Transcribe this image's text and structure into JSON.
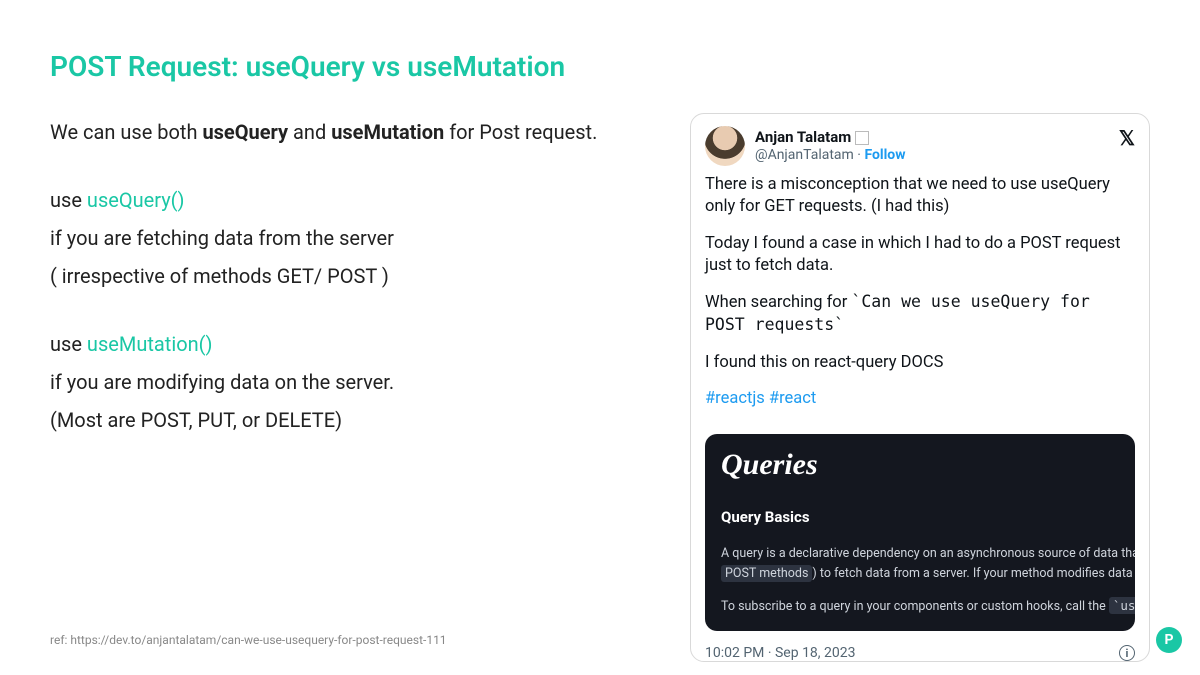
{
  "title": "POST Request: useQuery vs useMutation",
  "left": {
    "intro_pre": "We can use both ",
    "useQuery_b": "useQuery",
    "intro_mid": " and ",
    "useMutation_b": "useMutation",
    "intro_post": " for Post request.",
    "use_line1_pre": "use ",
    "useQuery_fn": "useQuery()",
    "useQuery_desc1": "if you are fetching data from the server",
    "useQuery_desc2": "( irrespective of methods GET/ POST )",
    "use_line2_pre": "use ",
    "useMutation_fn": "useMutation()",
    "useMutation_desc1": "if you are modifying data on the server.",
    "useMutation_desc2": "(Most are POST, PUT, or DELETE)"
  },
  "ref": "ref: https://dev.to/anjantalatam/can-we-use-usequery-for-post-request-111",
  "tweet": {
    "name": "Anjan Talatam",
    "handle": "@AnjanTalatam",
    "sep": " · ",
    "follow": "Follow",
    "x": "𝕏",
    "p1": "There is a misconception that we need to use useQuery only for GET requests. (I had this)",
    "p2": "Today I found a case in which I had to do a POST request just to fetch data.",
    "p3_pre": "When searching for ",
    "p3_code": "`Can we use useQuery for POST requests`",
    "p4": "I found this on react-query DOCS",
    "hashtags": "#reactjs #react",
    "docs": {
      "title": "Queries",
      "sub": "Query Basics",
      "line1_pre": "A query is a declarative dependency on an asynchronous source of data that is tie",
      "line2_pill": "POST methods",
      "line2_post": ") to fetch data from a server. If your method modifies data on the s",
      "line3_pre": "To subscribe to a query in your components or custom hooks, call the ",
      "line3_code": "`useQuery"
    },
    "timestamp": "10:02 PM · Sep 18, 2023",
    "info": "i"
  },
  "badge": "P"
}
